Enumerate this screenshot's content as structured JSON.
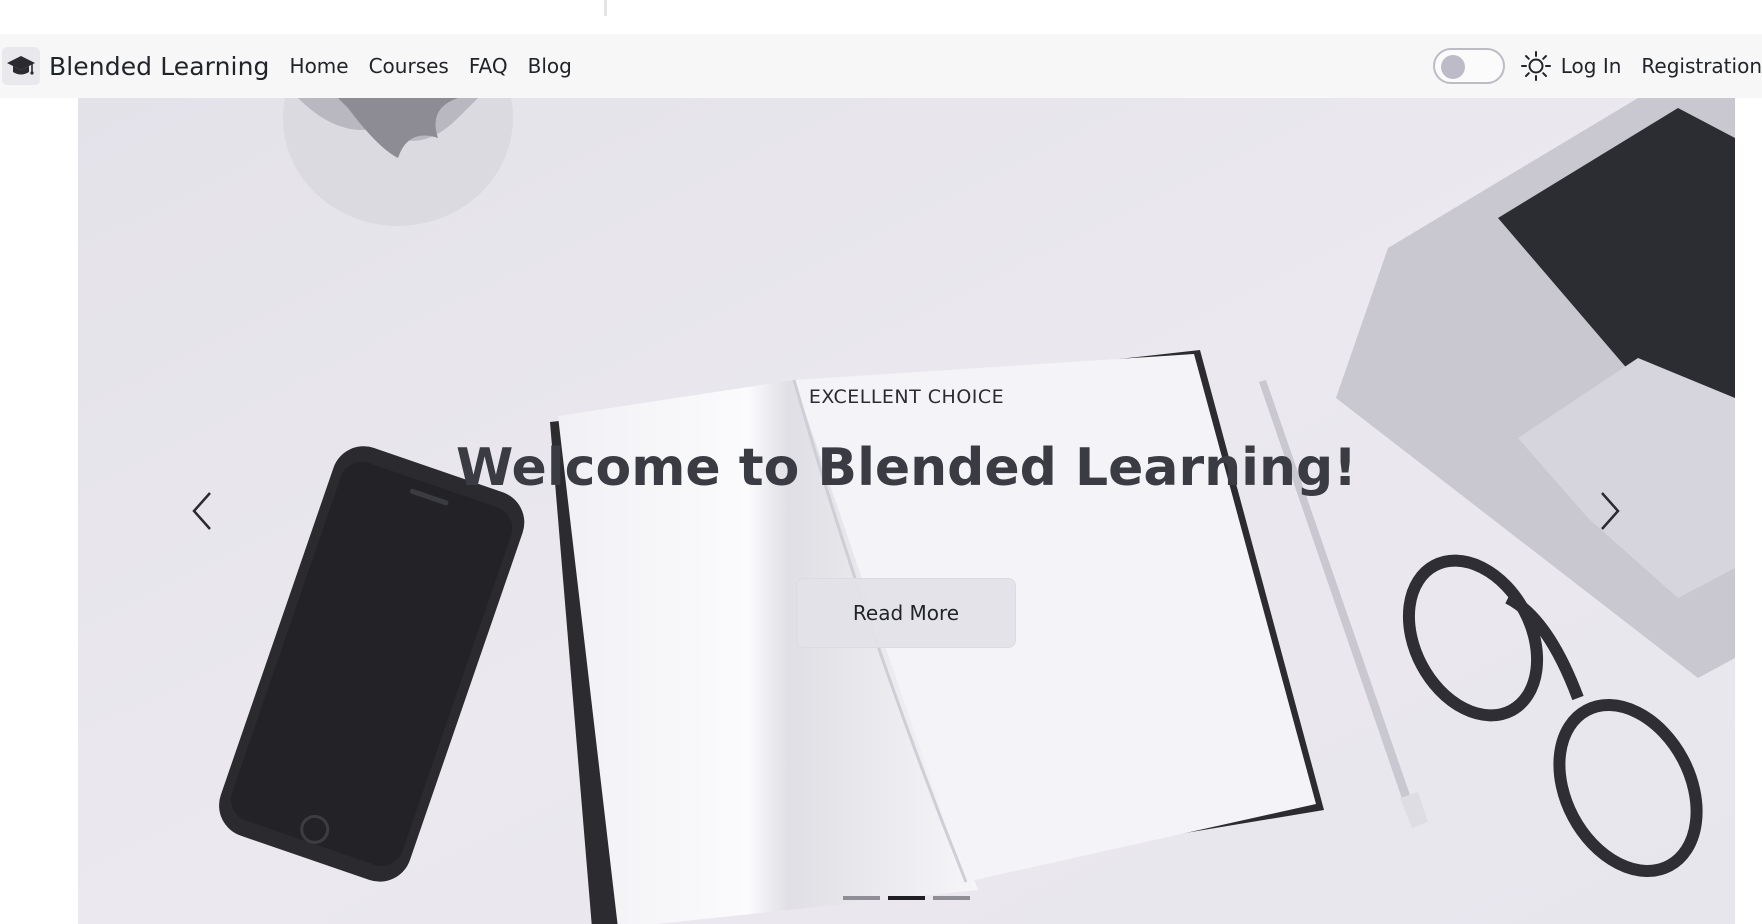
{
  "brand": {
    "name": "Blended Learning",
    "icon": "graduation-cap-icon"
  },
  "nav": {
    "links": [
      "Home",
      "Courses",
      "FAQ",
      "Blog"
    ]
  },
  "auth": {
    "login": "Log In",
    "register": "Registration"
  },
  "theme": {
    "toggle_state": "off",
    "icon": "sun-icon"
  },
  "hero": {
    "eyebrow": "EXCELLENT CHOICE",
    "title": "Welcome to Blended Learning!",
    "button": "Read More",
    "prev_icon": "chevron-left-icon",
    "next_icon": "chevron-right-icon",
    "slides_count": 3,
    "active_slide": 2
  },
  "colors": {
    "navbar_bg": "#f8f7f8",
    "hero_tint": "#e6e4eb",
    "text": "#212529",
    "title": "#3b3b43"
  }
}
